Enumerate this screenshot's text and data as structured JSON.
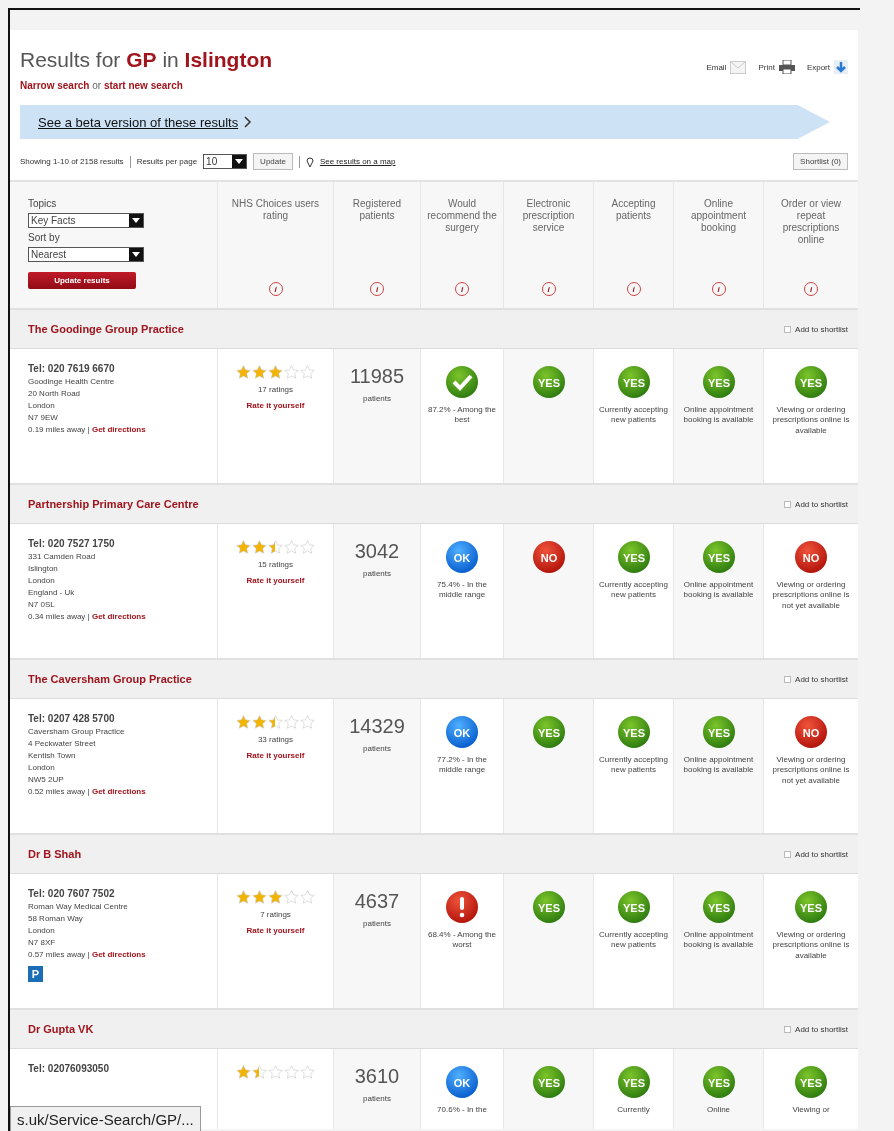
{
  "heading": {
    "prefix": "Results for",
    "service": "GP",
    "connector": "in",
    "place": "Islington"
  },
  "search_links": {
    "narrow": "Narrow search",
    "or": "or",
    "new": "start new search"
  },
  "tools": [
    {
      "label": "Email",
      "kind": "email"
    },
    {
      "label": "Print",
      "kind": "print"
    },
    {
      "label": "Export",
      "kind": "export"
    }
  ],
  "beta_banner": "See a beta version of these results",
  "results_bar": {
    "showing": "Showing 1-10 of 2158 results",
    "per_page_label": "Results per page",
    "per_page": "10",
    "update": "Update",
    "map_link": "See results on a map",
    "shortlist": "Shortlist (0)"
  },
  "filters": {
    "topics_label": "Topics",
    "topics": "Key Facts",
    "sort_label": "Sort by",
    "sort": "Nearest",
    "update": "Update results"
  },
  "columns": [
    {
      "label": "NHS Choices users rating",
      "info": "i"
    },
    {
      "label": "Registered patients",
      "info": "i"
    },
    {
      "label": "Would recommend the surgery",
      "info": "i"
    },
    {
      "label": "Electronic prescription service",
      "info": "i"
    },
    {
      "label": "Accepting patients",
      "info": "i"
    },
    {
      "label": "Online appointment booking",
      "info": "i"
    },
    {
      "label": "Order or view repeat prescriptions online",
      "info": "i"
    }
  ],
  "practices": [
    {
      "name": "The Goodinge Group Practice",
      "shortlist": "Add to shortlist",
      "shortlisted": false,
      "tel": "Tel: 020 7619 6670",
      "address": [
        "Goodinge Health Centre",
        "20 North Road",
        "London",
        "N7 9EW"
      ],
      "distance": "0.19 miles away |",
      "directions": "Get directions",
      "stars": 3,
      "ratings": "17 ratings",
      "rate": "Rate it yourself",
      "patients": "11985",
      "patients_label": "patients",
      "recommend": {
        "kind": "best",
        "text": "87.2% - Among the best"
      },
      "eps": {
        "kind": "yes",
        "badge": "YES"
      },
      "accepting": {
        "kind": "yes",
        "badge": "YES",
        "text": "Currently accepting new patients"
      },
      "booking": {
        "kind": "yes",
        "badge": "YES",
        "text": "Online appointment booking is available"
      },
      "repeat": {
        "kind": "yes",
        "badge": "YES",
        "text": "Viewing or ordering prescriptions online is available"
      }
    },
    {
      "name": "Partnership Primary Care Centre",
      "shortlist": "Add to shortlist",
      "shortlisted": false,
      "tel": "Tel: 020 7527 1750",
      "address": [
        "331 Camden Road",
        "Islington",
        "London",
        "England - Uk",
        "N7 0SL"
      ],
      "distance": "0.34 miles away |",
      "directions": "Get directions",
      "stars": 2.5,
      "ratings": "15 ratings",
      "rate": "Rate it yourself",
      "patients": "3042",
      "patients_label": "patients",
      "recommend": {
        "kind": "middle",
        "badge": "OK",
        "text": "75.4% - In the middle range"
      },
      "eps": {
        "kind": "no",
        "badge": "NO"
      },
      "accepting": {
        "kind": "yes",
        "badge": "YES",
        "text": "Currently accepting new patients"
      },
      "booking": {
        "kind": "yes",
        "badge": "YES",
        "text": "Online appointment booking is available"
      },
      "repeat": {
        "kind": "no",
        "badge": "NO",
        "text": "Viewing or ordering prescriptions online is not yet available"
      }
    },
    {
      "name": "The Caversham Group Practice",
      "shortlist": "Add to shortlist",
      "shortlisted": false,
      "tel": "Tel: 0207 428 5700",
      "address": [
        "Caversham Group Practice",
        "4 Peckwater Street",
        "Kentish Town",
        "London",
        "NW5 2UP"
      ],
      "distance": "0.52 miles away |",
      "directions": "Get directions",
      "stars": 2.5,
      "ratings": "33 ratings",
      "rate": "Rate it yourself",
      "patients": "14329",
      "patients_label": "patients",
      "recommend": {
        "kind": "middle",
        "badge": "OK",
        "text": "77.2% - In the middle range"
      },
      "eps": {
        "kind": "yes",
        "badge": "YES"
      },
      "accepting": {
        "kind": "yes",
        "badge": "YES",
        "text": "Currently accepting new patients"
      },
      "booking": {
        "kind": "yes",
        "badge": "YES",
        "text": "Online appointment booking is available"
      },
      "repeat": {
        "kind": "no",
        "badge": "NO",
        "text": "Viewing or ordering prescriptions online is not yet available"
      }
    },
    {
      "name": "Dr B Shah",
      "shortlist": "Add to shortlist",
      "shortlisted": false,
      "tel": "Tel: 020 7607 7502",
      "address": [
        "Roman Way Medical Centre",
        "58 Roman Way",
        "London",
        "N7 8XF"
      ],
      "distance": "0.57 miles away |",
      "directions": "Get directions",
      "parking": "P",
      "stars": 3,
      "ratings": "7 ratings",
      "rate": "Rate it yourself",
      "patients": "4637",
      "patients_label": "patients",
      "recommend": {
        "kind": "worst",
        "text": "68.4% - Among the worst"
      },
      "eps": {
        "kind": "yes",
        "badge": "YES"
      },
      "accepting": {
        "kind": "yes",
        "badge": "YES",
        "text": "Currently accepting new patients"
      },
      "booking": {
        "kind": "yes",
        "badge": "YES",
        "text": "Online appointment booking is available"
      },
      "repeat": {
        "kind": "yes",
        "badge": "YES",
        "text": "Viewing or ordering prescriptions online is available"
      }
    },
    {
      "name": "Dr Gupta VK",
      "shortlist": "Add to shortlist",
      "shortlisted": false,
      "tel": "Tel: 02076093050",
      "stars": 1.5,
      "patients": "3610",
      "patients_label": "patients",
      "recommend": {
        "kind": "middle",
        "badge": "OK",
        "text": "70.6% - In the"
      },
      "eps": {
        "kind": "yes",
        "badge": "YES"
      },
      "accepting": {
        "kind": "yes",
        "badge": "YES",
        "text": "Currently"
      },
      "booking": {
        "kind": "yes",
        "badge": "YES",
        "text": "Online"
      },
      "repeat": {
        "kind": "yes",
        "badge": "YES",
        "text": "Viewing or"
      }
    }
  ],
  "status_tooltip": "s.uk/Service-Search/GP/..."
}
